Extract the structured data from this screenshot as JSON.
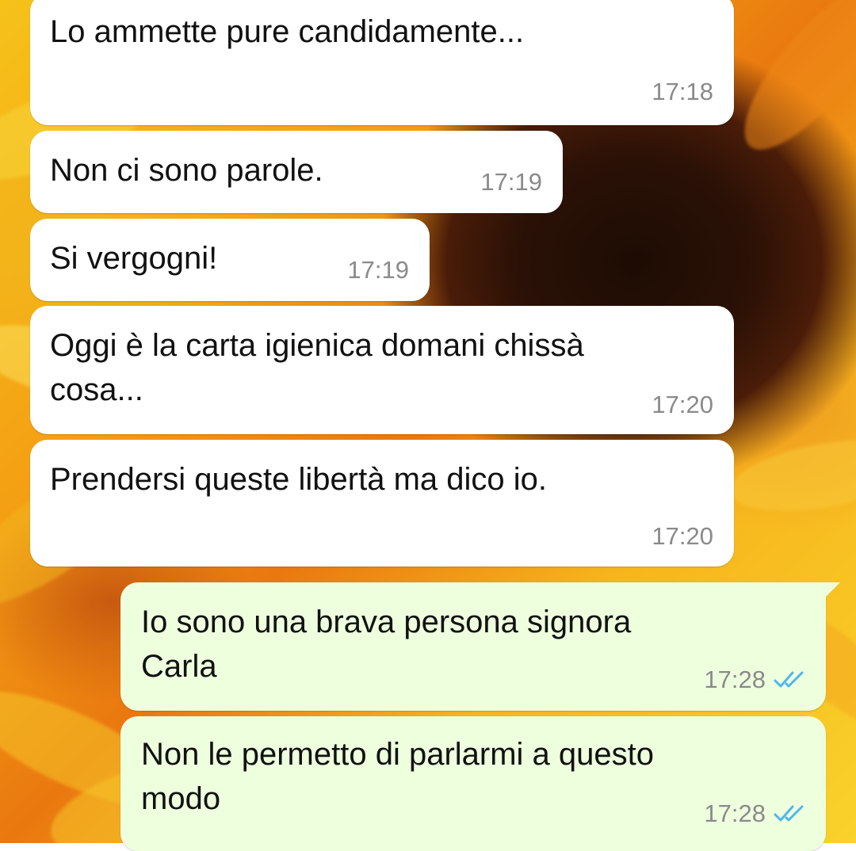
{
  "chat": {
    "messages": [
      {
        "direction": "incoming",
        "text": "Lo ammette pure candidamente...",
        "time": "17:18"
      },
      {
        "direction": "incoming",
        "text": "Non ci sono parole.",
        "time": "17:19"
      },
      {
        "direction": "incoming",
        "text": "Si vergogni!",
        "time": "17:19"
      },
      {
        "direction": "incoming",
        "text": "Oggi è la carta igienica domani chissà\ncosa...",
        "time": "17:20"
      },
      {
        "direction": "incoming",
        "text": "Prendersi queste libertà ma dico io.",
        "time": "17:20"
      },
      {
        "direction": "outgoing",
        "text": "Io sono una brava persona signora\nCarla",
        "time": "17:28",
        "status": "read"
      },
      {
        "direction": "outgoing",
        "text": "Non le permetto di parlarmi a questo\nmodo",
        "time": "17:28",
        "status": "read"
      }
    ]
  },
  "colors": {
    "incoming_bubble": "#ffffff",
    "outgoing_bubble": "#eeffde",
    "read_ticks": "#4fb6ec",
    "time_text": "#8a8a8a"
  },
  "icons": {
    "read_status": "double-check-icon"
  }
}
